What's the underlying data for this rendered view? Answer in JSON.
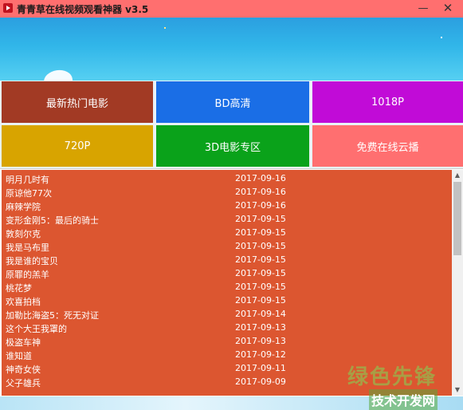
{
  "window": {
    "title": "青青草在线视频观看神器 v3.5",
    "minimize_label": "—",
    "close_label": "✕"
  },
  "tiles": [
    {
      "label": "最新热门电影",
      "color": "#a23a24"
    },
    {
      "label": "BD高清",
      "color": "#1a6ee6"
    },
    {
      "label": "1018P",
      "color": "#c10bd7"
    },
    {
      "label": "720P",
      "color": "#d8a400"
    },
    {
      "label": "3D电影专区",
      "color": "#0aa21a"
    },
    {
      "label": "免费在线云播",
      "color": "#ff6f70"
    }
  ],
  "list": {
    "background": "#dc5630",
    "rows": [
      {
        "title": "明月几时有",
        "date": "2017-09-16"
      },
      {
        "title": "原谅他77次",
        "date": "2017-09-16"
      },
      {
        "title": "麻辣学院",
        "date": "2017-09-16"
      },
      {
        "title": "变形金刚5：最后的骑士",
        "date": "2017-09-15"
      },
      {
        "title": "敦刻尔克",
        "date": "2017-09-15"
      },
      {
        "title": "我是马布里",
        "date": "2017-09-15"
      },
      {
        "title": "我是谁的宝贝",
        "date": "2017-09-15"
      },
      {
        "title": "原罪的羔羊",
        "date": "2017-09-15"
      },
      {
        "title": "桃花梦",
        "date": "2017-09-15"
      },
      {
        "title": "欢喜拍档",
        "date": "2017-09-15"
      },
      {
        "title": "加勒比海盗5：死无对证",
        "date": "2017-09-14"
      },
      {
        "title": "这个大王我罩的",
        "date": "2017-09-13"
      },
      {
        "title": "极盗车神",
        "date": "2017-09-13"
      },
      {
        "title": "谁知道",
        "date": "2017-09-12"
      },
      {
        "title": "神奇女侠",
        "date": "2017-09-11"
      },
      {
        "title": "父子雄兵",
        "date": "2017-09-09"
      },
      {
        "title": "",
        "date": ""
      }
    ]
  },
  "scrollbar": {
    "up_label": "▲",
    "down_label": "▼"
  },
  "watermark": {
    "top": "绿色先锋",
    "bottom": "技术开发网"
  }
}
